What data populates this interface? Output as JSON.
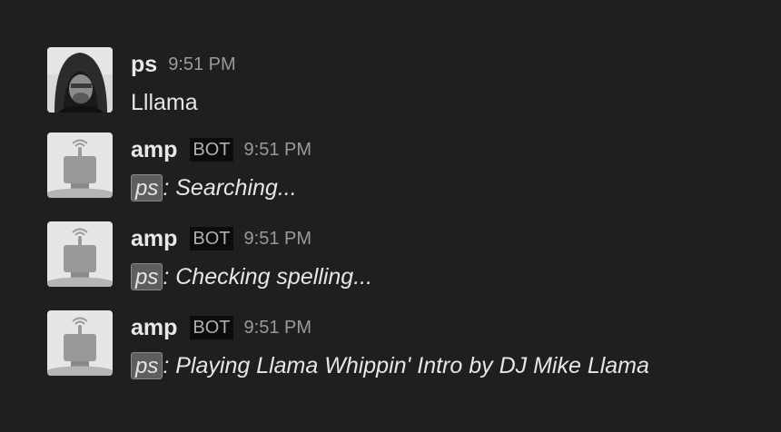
{
  "messages": [
    {
      "author": "ps",
      "time": "9:51 PM",
      "text": "Lllama",
      "avatar": "user-photo"
    },
    {
      "author": "amp",
      "badge": "BOT",
      "time": "9:51 PM",
      "mention": "ps",
      "text": ": Searching...",
      "avatar": "robot-icon"
    },
    {
      "author": "amp",
      "badge": "BOT",
      "time": "9:51 PM",
      "mention": "ps",
      "text": ": Checking spelling...",
      "avatar": "robot-icon"
    },
    {
      "author": "amp",
      "badge": "BOT",
      "time": "9:51 PM",
      "mention": "ps",
      "text": ": Playing Llama Whippin' Intro by DJ Mike Llama",
      "avatar": "robot-icon"
    }
  ],
  "colors": {
    "background": "#1f1f1f",
    "text": "#e6e6e6",
    "timestamp": "#9a9a9a",
    "badge_bg": "#0c0c0c",
    "mention_bg": "#5e5e5e"
  }
}
